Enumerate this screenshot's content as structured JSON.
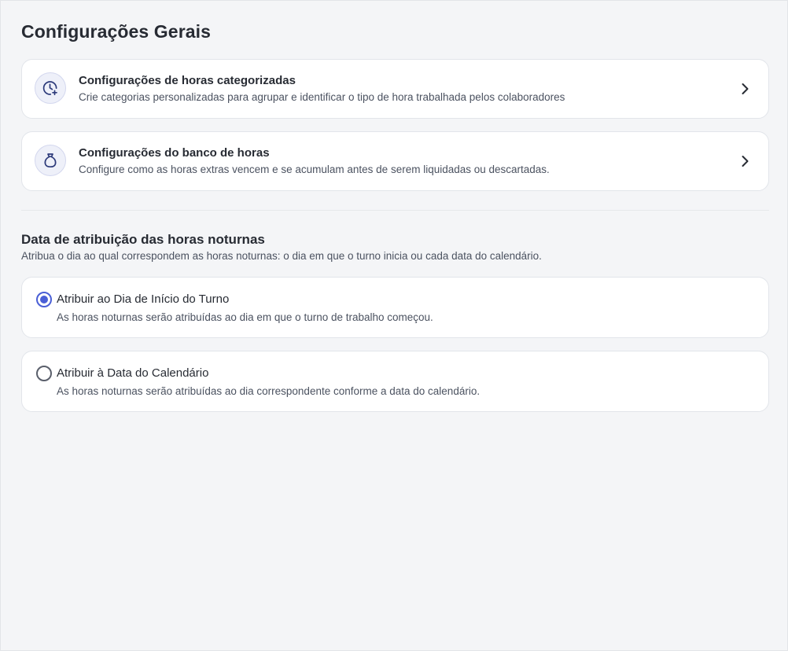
{
  "page": {
    "title": "Configurações Gerais"
  },
  "settings_cards": [
    {
      "title": "Configurações de horas categorizadas",
      "description": "Crie categorias personalizadas para agrupar e identificar o tipo de hora trabalhada pelos colaboradores",
      "icon": "clock-plus-icon"
    },
    {
      "title": "Configurações do banco de horas",
      "description": "Configure como as horas extras vencem e se acumulam antes de serem liquidadas ou descartadas.",
      "icon": "money-bag-icon"
    }
  ],
  "night_hours": {
    "title": "Data de atribuição das horas noturnas",
    "description": "Atribua o dia ao qual correspondem as horas noturnas: o dia em que o turno inicia ou cada data do calendário.",
    "options": [
      {
        "label": "Atribuir ao Dia de Início do Turno",
        "description": "As horas noturnas serão atribuídas ao dia em que o turno de trabalho começou.",
        "selected": true
      },
      {
        "label": "Atribuir à Data do Calendário",
        "description": "As horas noturnas serão atribuídas ao dia correspondente conforme a data do calendário.",
        "selected": false
      }
    ]
  },
  "colors": {
    "accent": "#4a5fd6",
    "background": "#f4f5f7",
    "card": "#ffffff",
    "icon_bg": "#eef0f9",
    "icon_stroke": "#2c3a7a"
  }
}
